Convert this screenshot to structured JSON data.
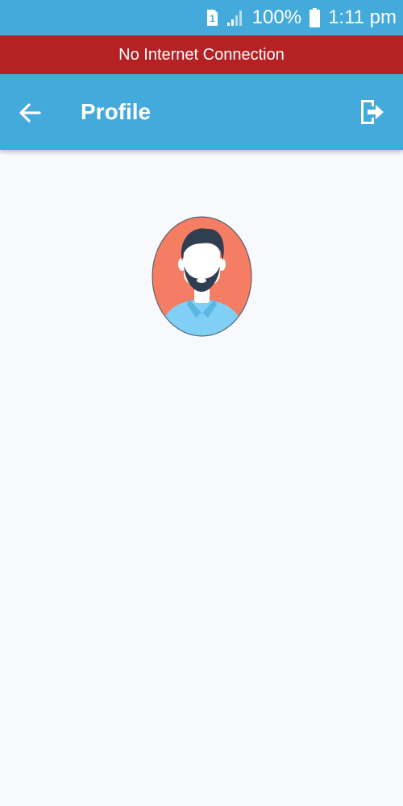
{
  "status_bar": {
    "sim_label": "1",
    "battery_text": "100%",
    "time": "1:11 pm",
    "icons": [
      "sim-icon",
      "signal-icon",
      "battery-icon"
    ]
  },
  "banner": {
    "text": "No Internet Connection",
    "color": "#b52224"
  },
  "app_bar": {
    "title": "Profile",
    "back_icon": "arrow-left-icon",
    "logout_icon": "logout-icon",
    "color": "#43aadb"
  },
  "profile": {
    "avatar_icon": "avatar-icon"
  },
  "colors": {
    "primary": "#43aadb",
    "background": "#f8f9fd",
    "avatar_bg": "#f47d64",
    "avatar_shirt": "#7fd0f4"
  }
}
